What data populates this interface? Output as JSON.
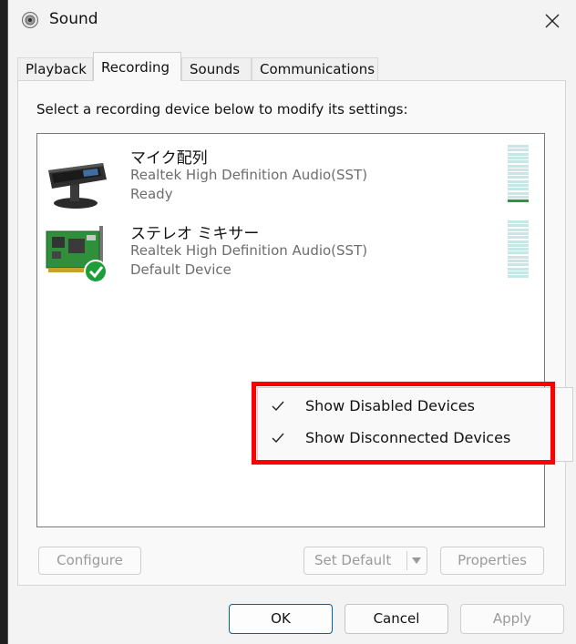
{
  "window": {
    "title": "Sound"
  },
  "tabs": [
    {
      "label": "Playback"
    },
    {
      "label": "Recording"
    },
    {
      "label": "Sounds"
    },
    {
      "label": "Communications"
    }
  ],
  "instruction": "Select a recording device below to modify its settings:",
  "devices": [
    {
      "name": "マイク配列",
      "driver": "Realtek High Definition Audio(SST)",
      "status": "Ready",
      "icon": "microphone-array-icon",
      "level_fraction": 0.07
    },
    {
      "name": "ステレオ ミキサー",
      "driver": "Realtek High Definition Audio(SST)",
      "status": "Default Device",
      "icon": "sound-card-icon",
      "level_fraction": 0.0
    }
  ],
  "buttons": {
    "configure": "Configure",
    "set_default": "Set Default",
    "properties": "Properties",
    "ok": "OK",
    "cancel": "Cancel",
    "apply": "Apply"
  },
  "context_menu": {
    "items": [
      {
        "label": "Show Disabled Devices",
        "checked": true
      },
      {
        "label": "Show Disconnected Devices",
        "checked": true
      }
    ]
  },
  "colors": {
    "highlight": "#ff0000",
    "meter_active": "#1e9e3a",
    "meter_idle": "#c9e6e6",
    "check_green": "#1e9e3a"
  }
}
